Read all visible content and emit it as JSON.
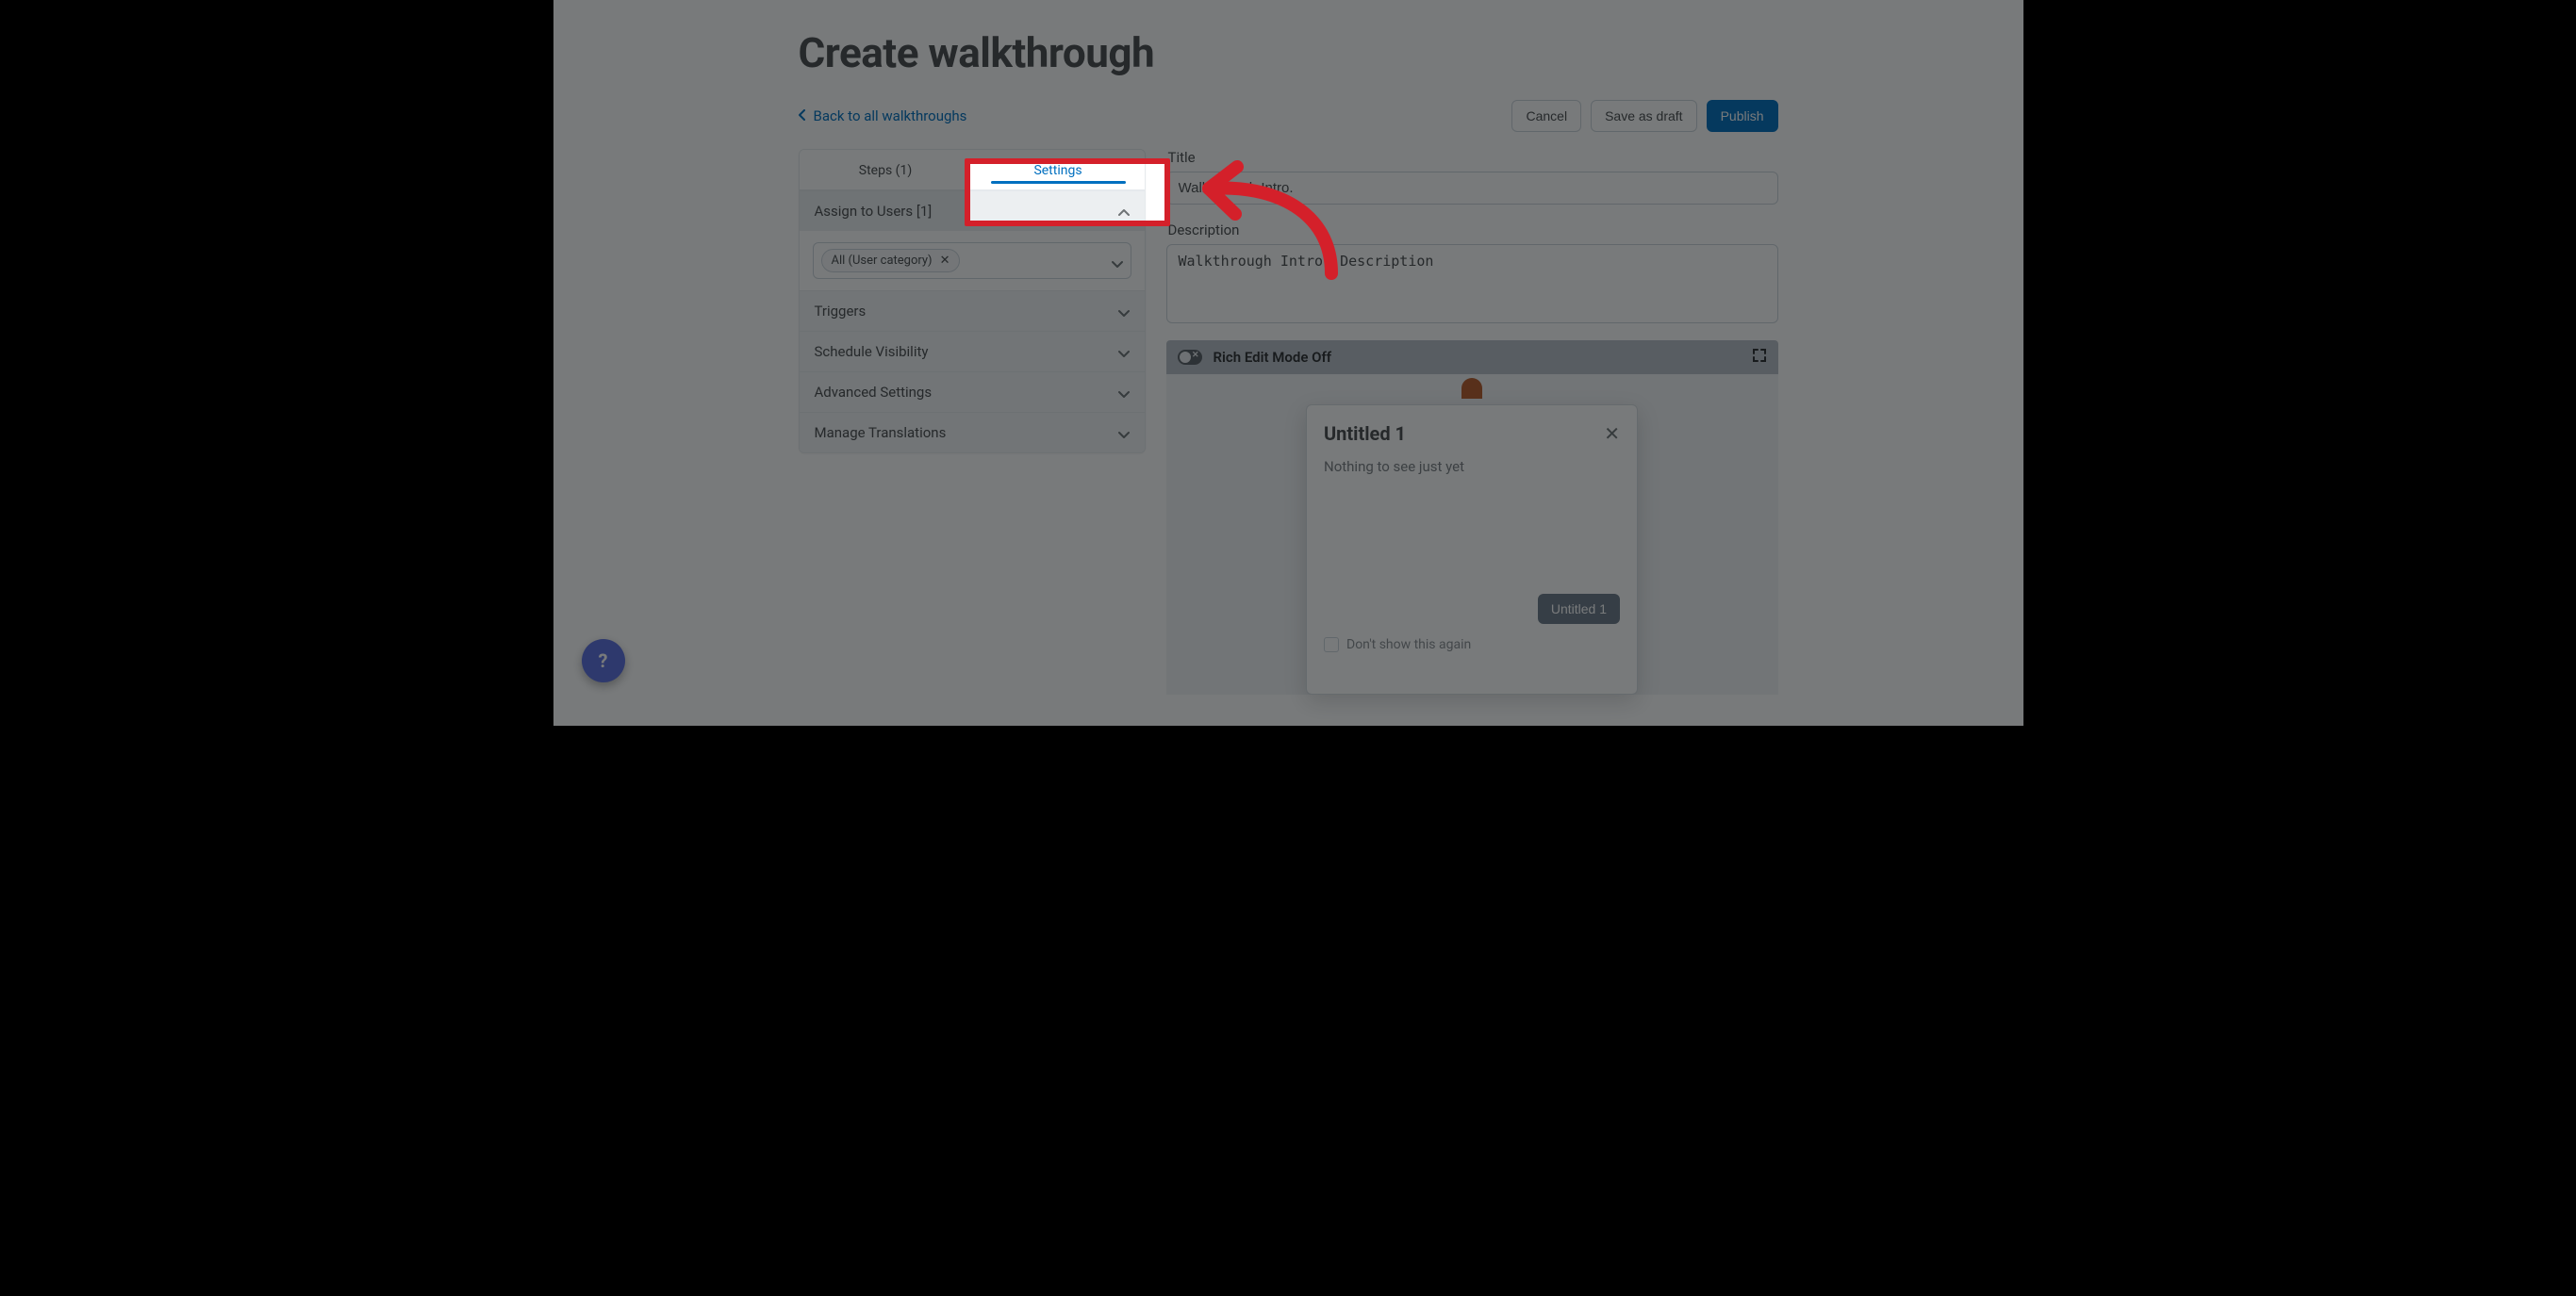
{
  "page": {
    "title": "Create walkthrough",
    "back_link": "Back to all walkthroughs",
    "buttons": {
      "cancel": "Cancel",
      "save_draft": "Save as draft",
      "publish": "Publish"
    }
  },
  "tabs": {
    "steps": "Steps (1)",
    "settings": "Settings"
  },
  "sidebar": {
    "assign_header": "Assign to Users [1]",
    "assign_chip": "All (User category)",
    "triggers": "Triggers",
    "schedule": "Schedule Visibility",
    "advanced": "Advanced Settings",
    "translations": "Manage Translations"
  },
  "form": {
    "title_label": "Title",
    "title_value": "Walkthrough Intro.",
    "description_label": "Description",
    "description_value": "Walkthrough Intro. Description"
  },
  "editorbar": {
    "toggle_label": "Rich Edit Mode Off"
  },
  "popup": {
    "title": "Untitled 1",
    "body": "Nothing to see just yet",
    "action": "Untitled 1",
    "dont_show": "Don't show this again"
  },
  "colors": {
    "accent": "#006fbf",
    "highlight": "#d4202a"
  }
}
